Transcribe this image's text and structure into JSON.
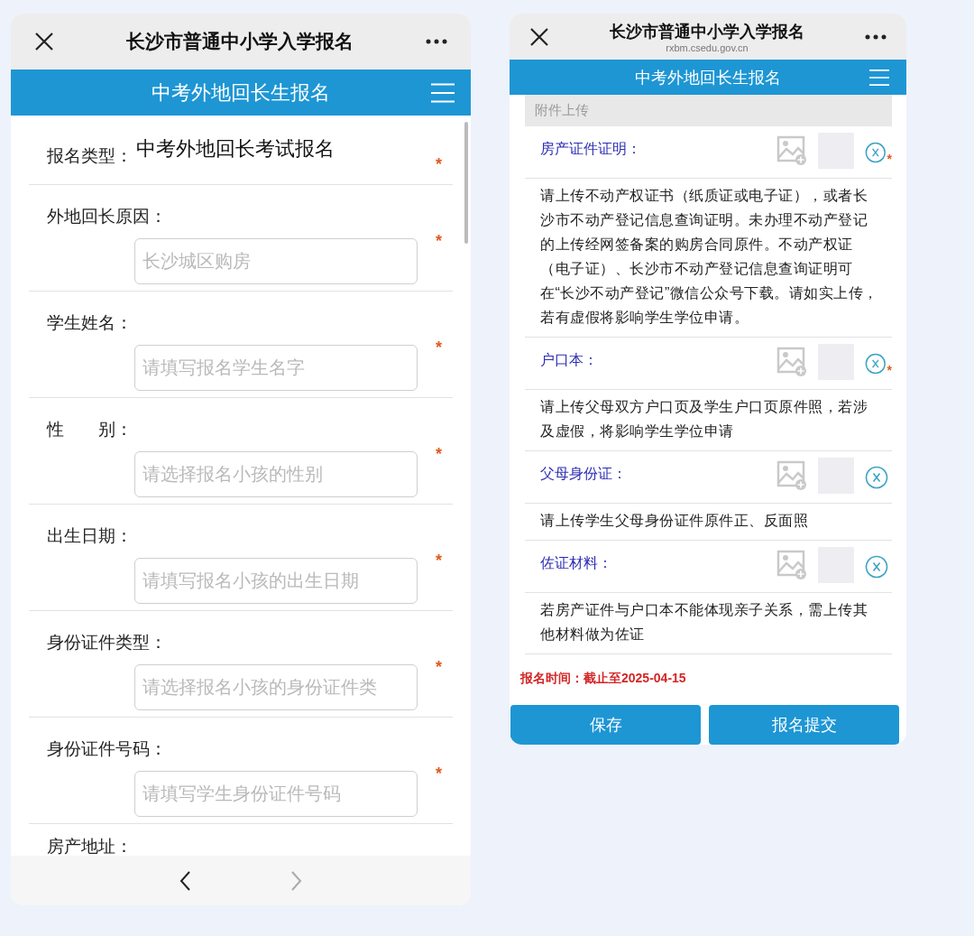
{
  "left_phone": {
    "title": "长沙市普通中小学入学报名",
    "header": "中考外地回长生报名",
    "form": {
      "type_field": {
        "label": "报名类型：",
        "value": "中考外地回长考试报名",
        "required_mark": "*"
      },
      "fields": [
        {
          "label": "外地回长原因：",
          "placeholder": "长沙城区购房",
          "required_mark": "*"
        },
        {
          "label": "学生姓名：",
          "placeholder": "请填写报名学生名字",
          "required_mark": "*"
        },
        {
          "label": "性　　别：",
          "placeholder": "请选择报名小孩的性别",
          "required_mark": "*"
        },
        {
          "label": "出生日期：",
          "placeholder": "请填写报名小孩的出生日期",
          "required_mark": "*"
        },
        {
          "label": "身份证件类型：",
          "placeholder": "请选择报名小孩的身份证件类",
          "required_mark": "*"
        },
        {
          "label": "身份证件号码：",
          "placeholder": "请填写学生身份证件号码",
          "required_mark": "*"
        }
      ],
      "next_label": "房产地址："
    },
    "nav": {
      "back_disabled": false,
      "forward_disabled": true
    }
  },
  "right_phone": {
    "title": "长沙市普通中小学入学报名",
    "url": "rxbm.csedu.gov.cn",
    "header": "中考外地回长生报名",
    "section": "附件上传",
    "uploads": [
      {
        "label": "房产证件证明：",
        "required_mark": "*",
        "note": "请上传不动产权证书（纸质证或电子证），或者长沙市不动产登记信息查询证明。未办理不动产登记的上传经网签备案的购房合同原件。不动产权证（电子证）、长沙市不动产登记信息查询证明可在“长沙不动产登记”微信公众号下载。请如实上传，若有虚假将影响学生学位申请。"
      },
      {
        "label": "户口本：",
        "required_mark": "*",
        "note": "请上传父母双方户口页及学生户口页原件照，若涉及虚假，将影响学生学位申请"
      },
      {
        "label": "父母身份证：",
        "note": "请上传学生父母身份证件原件正、反面照"
      },
      {
        "label": "佐证材料：",
        "note": "若房产证件与户口本不能体现亲子关系，需上传其他材料做为佐证"
      }
    ],
    "deadline": "报名时间：截止至2025-04-15",
    "buttons": [
      "保存",
      "报名提交"
    ]
  }
}
